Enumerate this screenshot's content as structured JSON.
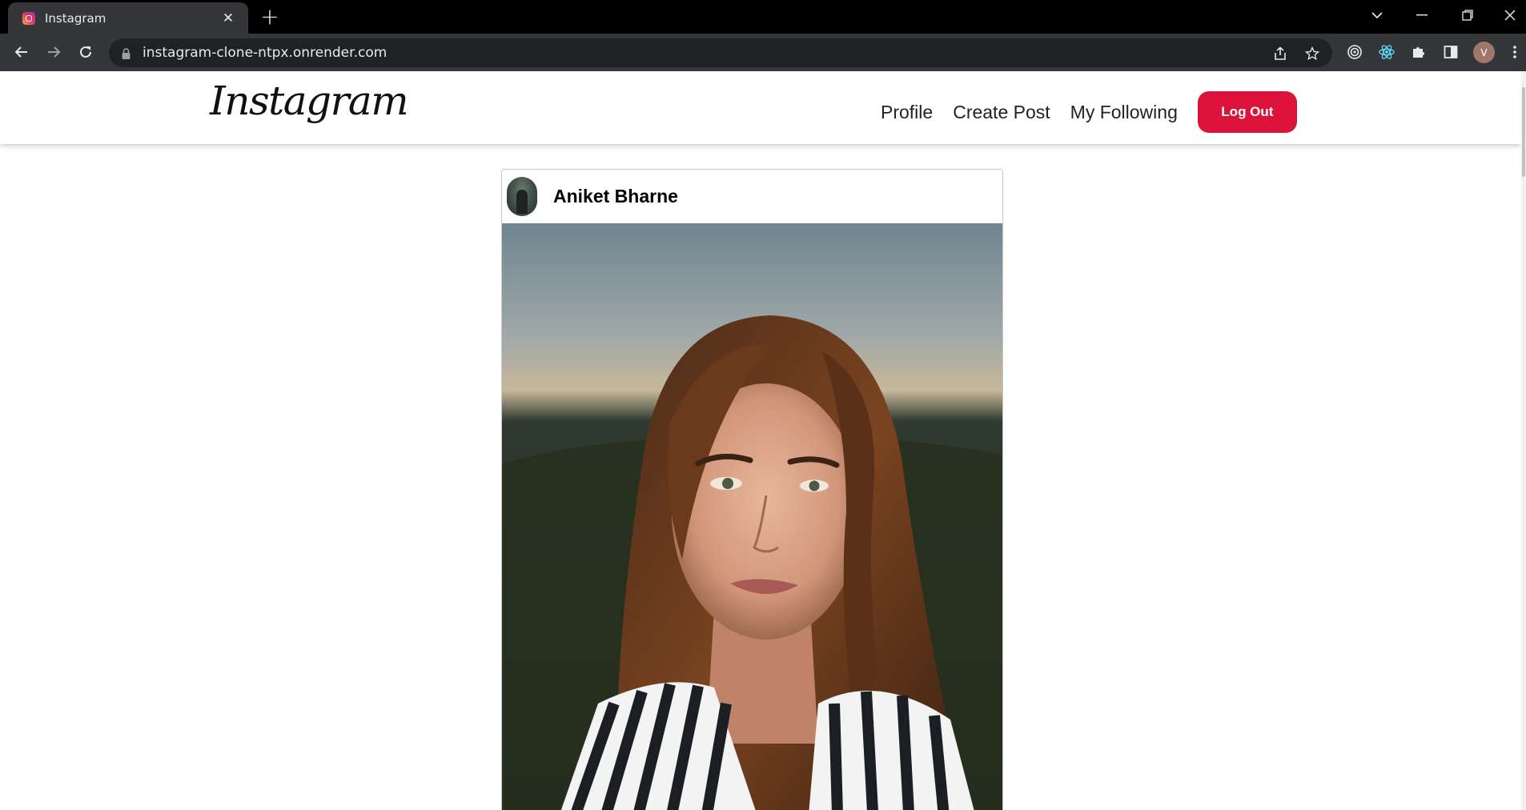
{
  "browser": {
    "tab_title": "Instagram",
    "favicon": "instagram-favicon-icon",
    "url": "instagram-clone-ntpx.onrender.com",
    "profile_initial": "V"
  },
  "navbar": {
    "logo_text": "Instagram",
    "links": [
      "Profile",
      "Create Post",
      "My Following"
    ],
    "logout_label": "Log Out",
    "logout_color": "#dc143c"
  },
  "post": {
    "author": "Aniket Bharne",
    "image_subject": "portrait-photo"
  }
}
